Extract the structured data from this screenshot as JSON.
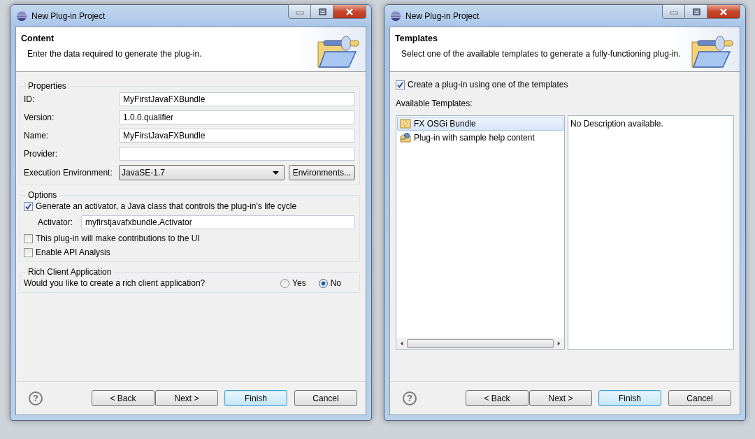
{
  "windows": [
    {
      "title": "New Plug-in Project",
      "header": {
        "title": "Content",
        "description": "Enter the data required to generate the plug-in."
      },
      "page": {
        "kind": "form",
        "groups": [
          {
            "title": "Properties",
            "rows": [
              {
                "kind": "field",
                "label": "ID:",
                "value": "MyFirstJavaFXBundle"
              },
              {
                "kind": "field",
                "label": "Version:",
                "value": "1.0.0.qualifier"
              },
              {
                "kind": "field",
                "label": "Name:",
                "value": "MyFirstJavaFXBundle"
              },
              {
                "kind": "field",
                "label": "Provider:"
              },
              {
                "kind": "combo",
                "label": "Execution Environment:",
                "value": "JavaSE-1.7",
                "button": "Environments..."
              }
            ]
          },
          {
            "title": "Options",
            "rows": [
              {
                "kind": "checkbox",
                "label": "Generate an activator, a Java class that controls the plug-in's life cycle",
                "checked": true
              },
              {
                "kind": "subfield",
                "label": "Activator:",
                "value": "myfirstjavafxbundle.Activator"
              },
              {
                "kind": "checkbox",
                "label": "This plug-in will make contributions to the UI",
                "checked": false
              },
              {
                "kind": "checkbox",
                "label": "Enable API Analysis",
                "checked": false
              }
            ]
          },
          {
            "title": "Rich Client Application",
            "rows": [
              {
                "kind": "radio_question",
                "label": "Would you like to create a rich client application?",
                "options": [
                  {
                    "label": "Yes",
                    "selected": false
                  },
                  {
                    "label": "No",
                    "selected": true
                  }
                ]
              }
            ]
          }
        ]
      },
      "help": "?",
      "buttons": [
        {
          "label": "< Back",
          "default": false
        },
        {
          "label": "Next >",
          "default": false
        },
        {
          "label": "Finish",
          "default": true
        },
        {
          "label": "Cancel",
          "default": false
        }
      ]
    },
    {
      "title": "New Plug-in Project",
      "header": {
        "title": "Templates",
        "description": "Select one of the available templates to generate a fully-functioning plug-in."
      },
      "page": {
        "kind": "templates",
        "checkbox": {
          "label": "Create a plug-in using one of the templates",
          "checked": true
        },
        "list_label": "Available Templates:",
        "templates": [
          {
            "label": "FX OSGi Bundle",
            "selected": true
          },
          {
            "label": "Plug-in with sample help content",
            "selected": false
          }
        ],
        "description": "No Description available."
      },
      "help": "?",
      "buttons": [
        {
          "label": "< Back",
          "default": false
        },
        {
          "label": "Next >",
          "default": false
        },
        {
          "label": "Finish",
          "default": true
        },
        {
          "label": "Cancel",
          "default": false
        }
      ]
    }
  ]
}
